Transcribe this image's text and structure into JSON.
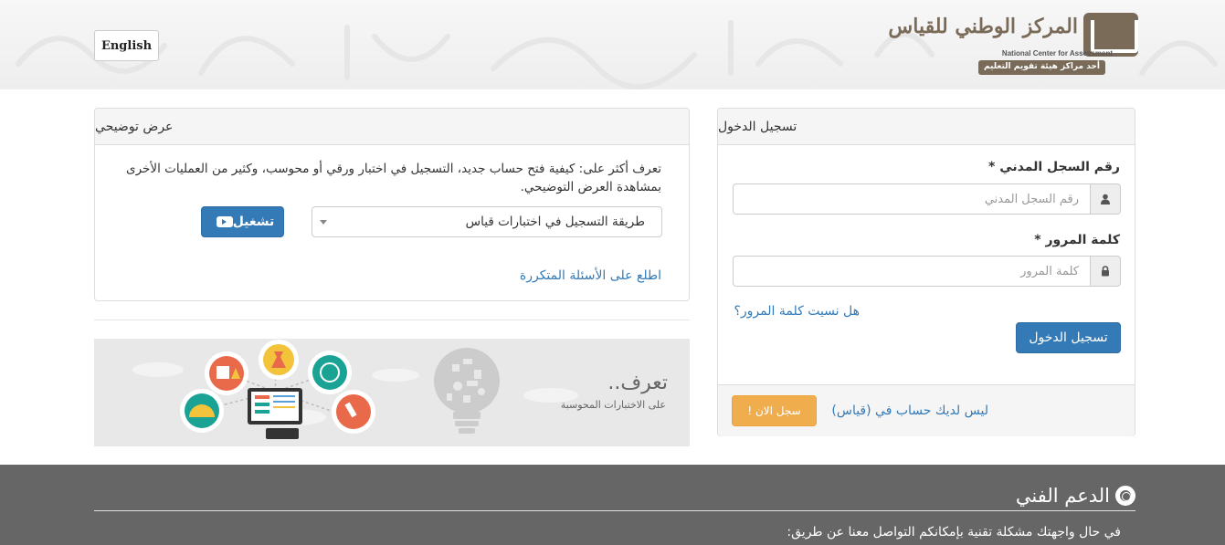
{
  "header": {
    "lang_button": "English",
    "logo_arabic": "المركز الوطني للقياس",
    "logo_english": "National Center for Assessment",
    "logo_tagline": "أحد مراكز هيئة تقويم التعليم"
  },
  "login": {
    "title": "تسجيل الدخول",
    "id_label": "رقم السجل المدني *",
    "id_placeholder": "رقم السجل المدني",
    "password_label": "كلمة المرور *",
    "password_placeholder": "كلمة المرور",
    "forgot_link": "هل نسيت كلمة المرور؟",
    "submit_button": "تسجيل الدخول",
    "no_account_text": "ليس لديك حساب في (قياس)",
    "register_button": "سجل الان !"
  },
  "demo": {
    "title": "عرض توضيحي",
    "description": "تعرف أكثر على: كيفية فتح حساب جديد، التسجيل في اختبار ورقي أو محوسب، وكثير من العمليات الأخرى بمشاهدة العرض التوضيحي.",
    "select_value": "طريقة التسجيل في اختبارات قياس",
    "play_button": "تشغيل",
    "faq_link": "اطلع على الأسئلة المتكررة"
  },
  "banner": {
    "title": "تعرف..",
    "subtitle": "على الاختبارات المحوسبة"
  },
  "footer": {
    "support_title": "الدعم الفني",
    "support_text": "في حال واجهتك مشكلة تقنية بإمكانكم التواصل معنا عن طريق:"
  },
  "colors": {
    "primary": "#337ab7",
    "warning": "#f0ad4e",
    "footer_bg": "#666666",
    "logo_brown": "#7a6a58"
  }
}
